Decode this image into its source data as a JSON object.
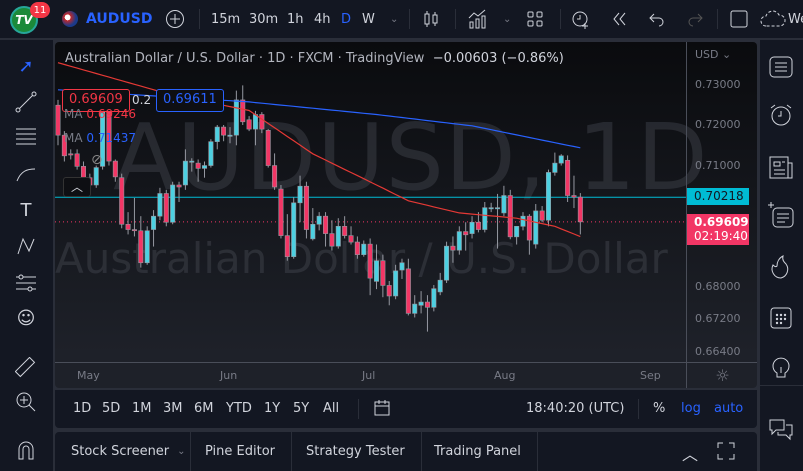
{
  "topbar": {
    "logo_text": "TV",
    "notifications": "11",
    "symbol": "AUDUSD",
    "intervals": [
      "15m",
      "30m",
      "1h",
      "4h",
      "D",
      "W"
    ],
    "active_interval": "D",
    "cloud_label": "We"
  },
  "chart": {
    "legend_title": "Australian Dollar / U.S. Dollar · 1D · FXCM · TradingView",
    "change": "−0.00603 (−0.86%)",
    "sell_price": "0.69609",
    "spread": "0.2",
    "buy_price": "0.69611",
    "ma1_label": "MA",
    "ma1_value": "0.69246",
    "ma2_label": "MA",
    "ma2_value": "0.71437",
    "watermark_symbol": "AUDUSD, 1D",
    "watermark_name": "Australian Dollar / U.S. Dollar",
    "currency": "USD",
    "price_ticks": [
      "0.73000",
      "0.72000",
      "0.71000",
      "0.68000",
      "0.67200",
      "0.66400"
    ],
    "price_tick_values": [
      0.73,
      0.72,
      0.71,
      0.68,
      0.672,
      0.664
    ],
    "hline_label": "0.70218",
    "hline_value": 0.70218,
    "last_price_label": "0.69609",
    "last_price_value": 0.69609,
    "countdown": "02:19:40",
    "months": [
      "May",
      "Jun",
      "Jul",
      "Aug",
      "Sep"
    ],
    "colors": {
      "up": "#4dd0e1",
      "down": "#f23665",
      "ma1": "#e53935",
      "ma2": "#2962ff",
      "hline": "#00bcd4"
    }
  },
  "chart_data": {
    "type": "candlestick",
    "ohlc": [
      [
        0.7249,
        0.7262,
        0.715,
        0.7175
      ],
      [
        0.7175,
        0.7185,
        0.711,
        0.7124
      ],
      [
        0.7129,
        0.714,
        0.7115,
        0.7128
      ],
      [
        0.7129,
        0.714,
        0.709,
        0.7098
      ],
      [
        0.7098,
        0.711,
        0.7055,
        0.7065
      ],
      [
        0.707,
        0.708,
        0.704,
        0.7052
      ],
      [
        0.7052,
        0.71,
        0.7045,
        0.7095
      ],
      [
        0.7098,
        0.7262,
        0.709,
        0.7257
      ],
      [
        0.7257,
        0.7265,
        0.71,
        0.7111
      ],
      [
        0.7111,
        0.7115,
        0.706,
        0.7072
      ],
      [
        0.707,
        0.708,
        0.6945,
        0.6955
      ],
      [
        0.6955,
        0.6985,
        0.693,
        0.6942
      ],
      [
        0.6942,
        0.702,
        0.6925,
        0.694
      ],
      [
        0.6939,
        0.6975,
        0.6848,
        0.686
      ],
      [
        0.686,
        0.695,
        0.6855,
        0.6939
      ],
      [
        0.6942,
        0.699,
        0.69,
        0.6975
      ],
      [
        0.6975,
        0.7045,
        0.6965,
        0.7031
      ],
      [
        0.7031,
        0.704,
        0.695,
        0.696
      ],
      [
        0.696,
        0.706,
        0.6955,
        0.7052
      ],
      [
        0.7052,
        0.706,
        0.701,
        0.7047
      ],
      [
        0.7052,
        0.714,
        0.704,
        0.7111
      ],
      [
        0.7111,
        0.7118,
        0.7085,
        0.7111
      ],
      [
        0.7106,
        0.7115,
        0.706,
        0.7093
      ],
      [
        0.7093,
        0.711,
        0.707,
        0.71
      ],
      [
        0.71,
        0.7165,
        0.7095,
        0.7159
      ],
      [
        0.7159,
        0.72,
        0.714,
        0.7195
      ],
      [
        0.7195,
        0.72,
        0.716,
        0.7175
      ],
      [
        0.7175,
        0.7195,
        0.7155,
        0.7175
      ],
      [
        0.7175,
        0.7285,
        0.715,
        0.7262
      ],
      [
        0.7262,
        0.7298,
        0.72,
        0.7208
      ],
      [
        0.7213,
        0.7222,
        0.7185,
        0.719
      ],
      [
        0.719,
        0.7235,
        0.715,
        0.7226
      ],
      [
        0.7226,
        0.7232,
        0.718,
        0.719
      ],
      [
        0.7187,
        0.719,
        0.7095,
        0.71
      ],
      [
        0.71,
        0.713,
        0.704,
        0.7047
      ],
      [
        0.7042,
        0.7052,
        0.692,
        0.6927
      ],
      [
        0.6927,
        0.698,
        0.6865,
        0.6875
      ],
      [
        0.6875,
        0.7022,
        0.687,
        0.7008
      ],
      [
        0.7008,
        0.7075,
        0.696,
        0.7049
      ],
      [
        0.7049,
        0.706,
        0.692,
        0.6942
      ],
      [
        0.6919,
        0.6995,
        0.6915,
        0.6955
      ],
      [
        0.6955,
        0.6985,
        0.694,
        0.6975
      ],
      [
        0.6975,
        0.6985,
        0.69,
        0.6932
      ],
      [
        0.6932,
        0.6965,
        0.689,
        0.6901
      ],
      [
        0.6901,
        0.697,
        0.6895,
        0.695
      ],
      [
        0.695,
        0.6975,
        0.692,
        0.6927
      ],
      [
        0.6927,
        0.695,
        0.6905,
        0.6911
      ],
      [
        0.6911,
        0.6925,
        0.687,
        0.688
      ],
      [
        0.688,
        0.6915,
        0.6875,
        0.6906
      ],
      [
        0.6906,
        0.692,
        0.678,
        0.6822
      ],
      [
        0.6814,
        0.6905,
        0.6795,
        0.6865
      ],
      [
        0.6865,
        0.688,
        0.6775,
        0.6804
      ],
      [
        0.6804,
        0.6815,
        0.6755,
        0.6778
      ],
      [
        0.6778,
        0.6855,
        0.677,
        0.684
      ],
      [
        0.6842,
        0.687,
        0.682,
        0.686
      ],
      [
        0.6845,
        0.687,
        0.673,
        0.6735
      ],
      [
        0.6735,
        0.678,
        0.6725,
        0.6758
      ],
      [
        0.6755,
        0.679,
        0.6735,
        0.6763
      ],
      [
        0.6763,
        0.678,
        0.669,
        0.675
      ],
      [
        0.675,
        0.6805,
        0.674,
        0.6796
      ],
      [
        0.6788,
        0.6835,
        0.678,
        0.6817
      ],
      [
        0.6817,
        0.6912,
        0.681,
        0.6901
      ],
      [
        0.6901,
        0.6925,
        0.686,
        0.6891
      ],
      [
        0.6891,
        0.695,
        0.688,
        0.6937
      ],
      [
        0.6937,
        0.696,
        0.689,
        0.6929
      ],
      [
        0.6932,
        0.6975,
        0.692,
        0.696
      ],
      [
        0.696,
        0.6985,
        0.6935,
        0.6942
      ],
      [
        0.6942,
        0.701,
        0.6935,
        0.6996
      ],
      [
        0.6996,
        0.7008,
        0.6985,
        0.6996
      ],
      [
        0.6996,
        0.703,
        0.6895,
        0.6996
      ],
      [
        0.6983,
        0.705,
        0.6975,
        0.7026
      ],
      [
        0.7026,
        0.704,
        0.6918,
        0.6924
      ],
      [
        0.6924,
        0.695,
        0.6905,
        0.695
      ],
      [
        0.695,
        0.6985,
        0.694,
        0.6975
      ],
      [
        0.6975,
        0.698,
        0.688,
        0.6916
      ],
      [
        0.6906,
        0.7005,
        0.6895,
        0.6988
      ],
      [
        0.6988,
        0.7,
        0.696,
        0.6965
      ],
      [
        0.6965,
        0.709,
        0.695,
        0.7083
      ],
      [
        0.7083,
        0.7132,
        0.7075,
        0.7106
      ],
      [
        0.7106,
        0.7128,
        0.71,
        0.7124
      ],
      [
        0.7113,
        0.7125,
        0.701,
        0.7026
      ],
      [
        0.7026,
        0.7075,
        0.6995,
        0.7022
      ],
      [
        0.7022,
        0.7032,
        0.693,
        0.6961
      ]
    ],
    "ma1_anchors": [
      [
        0,
        0.7354
      ],
      [
        18,
        0.7274
      ],
      [
        30,
        0.7236
      ],
      [
        40,
        0.7129
      ],
      [
        50,
        0.7052
      ],
      [
        55,
        0.7013
      ],
      [
        63,
        0.6983
      ],
      [
        72,
        0.697
      ],
      [
        78,
        0.695
      ],
      [
        82,
        0.69246
      ]
    ],
    "ma2_anchors": [
      [
        0,
        0.7287
      ],
      [
        30,
        0.7257
      ],
      [
        50,
        0.7226
      ],
      [
        65,
        0.7198
      ],
      [
        82,
        0.71437
      ]
    ],
    "ylim": [
      0.6615,
      0.7405
    ],
    "x_months": [
      "May",
      "Jun",
      "Jul",
      "Aug",
      "Sep"
    ]
  },
  "rangebar": {
    "ranges": [
      "1D",
      "5D",
      "1M",
      "3M",
      "6M",
      "YTD",
      "1Y",
      "5Y",
      "All"
    ],
    "time": "18:40:20 (UTC)",
    "percent": "%",
    "log": "log",
    "auto": "auto"
  },
  "bottompanel": {
    "tabs": [
      "Stock Screener",
      "Pine Editor",
      "Strategy Tester",
      "Trading Panel"
    ]
  }
}
